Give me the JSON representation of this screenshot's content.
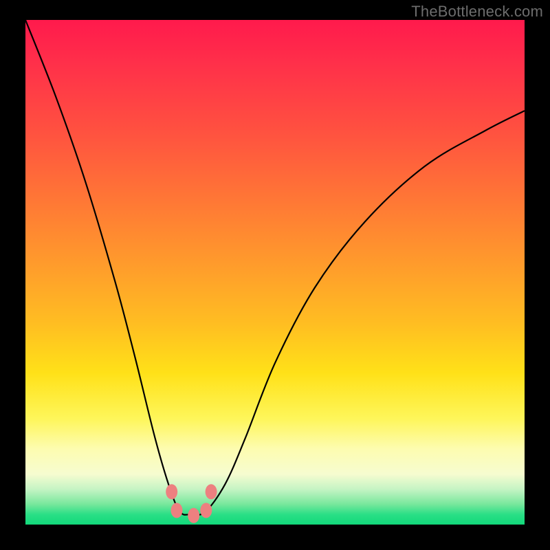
{
  "watermark": "TheBottleneck.com",
  "chart_data": {
    "type": "line",
    "title": "",
    "xlabel": "",
    "ylabel": "",
    "xlim": [
      0,
      1
    ],
    "ylim": [
      0,
      1
    ],
    "series": [
      {
        "name": "curve",
        "x": [
          0.0,
          0.06,
          0.12,
          0.18,
          0.22,
          0.26,
          0.29,
          0.31,
          0.33,
          0.36,
          0.4,
          0.44,
          0.5,
          0.58,
          0.68,
          0.8,
          0.92,
          1.0
        ],
        "values": [
          1.0,
          0.85,
          0.68,
          0.48,
          0.33,
          0.17,
          0.07,
          0.025,
          0.02,
          0.025,
          0.08,
          0.17,
          0.32,
          0.47,
          0.6,
          0.71,
          0.78,
          0.82
        ]
      }
    ],
    "markers": [
      {
        "name": "marker-left-top",
        "x": 0.293,
        "y": 0.065
      },
      {
        "name": "marker-left-bottom",
        "x": 0.303,
        "y": 0.028
      },
      {
        "name": "marker-center",
        "x": 0.337,
        "y": 0.018
      },
      {
        "name": "marker-right-bottom",
        "x": 0.362,
        "y": 0.028
      },
      {
        "name": "marker-right-top",
        "x": 0.372,
        "y": 0.065
      }
    ],
    "marker_color": "#ed8080",
    "curve_color": "#000000",
    "background_gradient": [
      "#ff1a4c",
      "#ffe118",
      "#12d87a"
    ]
  }
}
